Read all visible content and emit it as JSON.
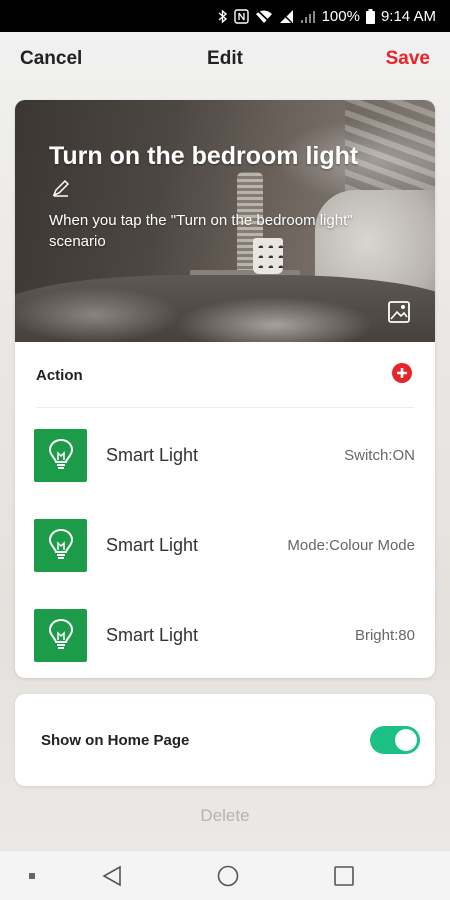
{
  "status_bar": {
    "battery": "100%",
    "time": "9:14 AM"
  },
  "header": {
    "cancel_label": "Cancel",
    "title": "Edit",
    "save_label": "Save"
  },
  "scene": {
    "title": "Turn on the bedroom light",
    "description": "When you tap the \"Turn on the bedroom light\" scenario"
  },
  "actions": {
    "section_label": "Action",
    "items": [
      {
        "device": "Smart Light",
        "value": "Switch:ON"
      },
      {
        "device": "Smart Light",
        "value": "Mode:Colour Mode"
      },
      {
        "device": "Smart Light",
        "value": "Bright:80"
      }
    ]
  },
  "home_page": {
    "label": "Show on Home Page",
    "enabled": true
  },
  "delete_label": "Delete",
  "colors": {
    "save": "#e8232a",
    "add_action": "#e8232a",
    "device_tile": "#1c9c48",
    "toggle_on": "#1dc185",
    "delete": "#b4b4b4"
  }
}
